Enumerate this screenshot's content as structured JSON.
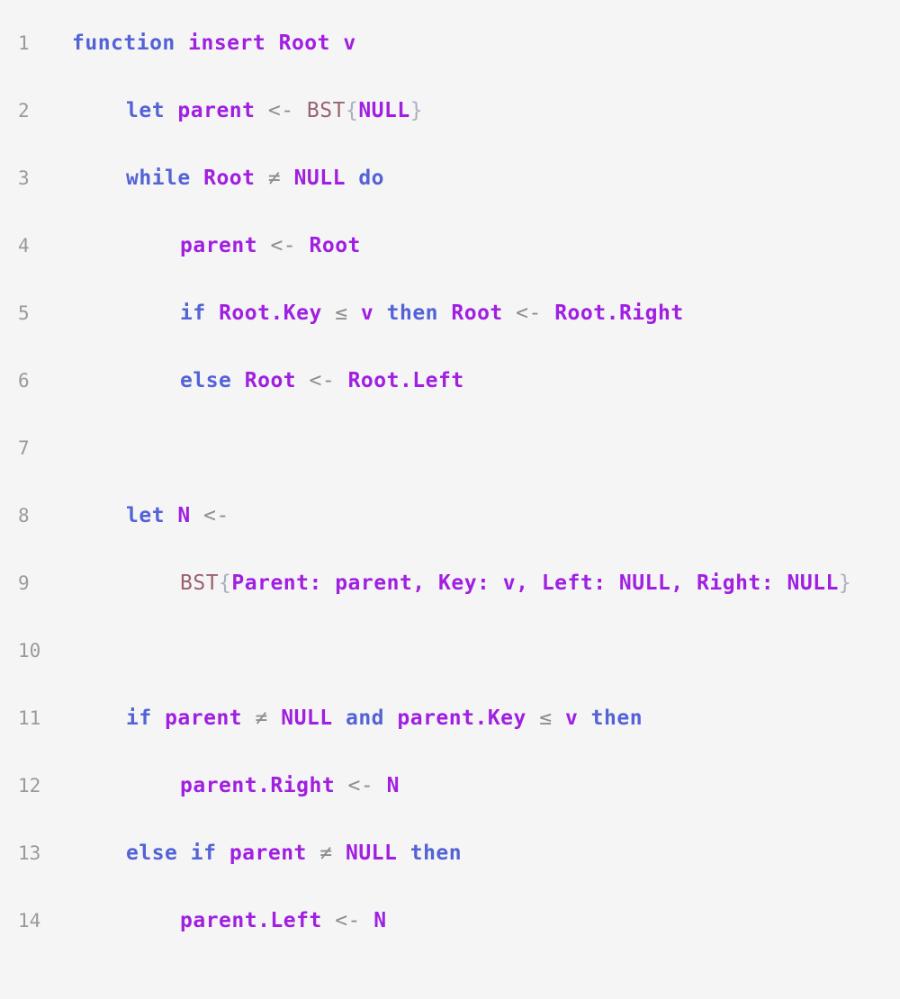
{
  "editor": {
    "lines": [
      {
        "number": "1",
        "indent": 0,
        "tokens": [
          {
            "t": "function",
            "k": "keyword"
          },
          {
            "t": " ",
            "k": "op"
          },
          {
            "t": "insert",
            "k": "ident"
          },
          {
            "t": " ",
            "k": "op"
          },
          {
            "t": "Root",
            "k": "ident"
          },
          {
            "t": " ",
            "k": "op"
          },
          {
            "t": "v",
            "k": "ident"
          }
        ]
      },
      {
        "number": "2",
        "indent": 1,
        "tokens": [
          {
            "t": "let",
            "k": "keyword"
          },
          {
            "t": " ",
            "k": "op"
          },
          {
            "t": "parent",
            "k": "ident"
          },
          {
            "t": " ",
            "k": "op"
          },
          {
            "t": "<-",
            "k": "op"
          },
          {
            "t": " ",
            "k": "op"
          },
          {
            "t": "BST",
            "k": "type"
          },
          {
            "t": "{",
            "k": "brace"
          },
          {
            "t": "NULL",
            "k": "ident"
          },
          {
            "t": "}",
            "k": "brace"
          }
        ]
      },
      {
        "number": "3",
        "indent": 1,
        "tokens": [
          {
            "t": "while",
            "k": "keyword"
          },
          {
            "t": " ",
            "k": "op"
          },
          {
            "t": "Root",
            "k": "ident"
          },
          {
            "t": " ",
            "k": "op"
          },
          {
            "t": "≠",
            "k": "op"
          },
          {
            "t": " ",
            "k": "op"
          },
          {
            "t": "NULL",
            "k": "ident"
          },
          {
            "t": " ",
            "k": "op"
          },
          {
            "t": "do",
            "k": "keyword"
          }
        ]
      },
      {
        "number": "4",
        "indent": 2,
        "tokens": [
          {
            "t": "parent",
            "k": "ident"
          },
          {
            "t": " ",
            "k": "op"
          },
          {
            "t": "<-",
            "k": "op"
          },
          {
            "t": " ",
            "k": "op"
          },
          {
            "t": "Root",
            "k": "ident"
          }
        ]
      },
      {
        "number": "5",
        "indent": 2,
        "tokens": [
          {
            "t": "if",
            "k": "keyword"
          },
          {
            "t": " ",
            "k": "op"
          },
          {
            "t": "Root.Key",
            "k": "ident"
          },
          {
            "t": " ",
            "k": "op"
          },
          {
            "t": "≤",
            "k": "op"
          },
          {
            "t": " ",
            "k": "op"
          },
          {
            "t": "v",
            "k": "ident"
          },
          {
            "t": " ",
            "k": "op"
          },
          {
            "t": "then",
            "k": "keyword"
          },
          {
            "t": " ",
            "k": "op"
          },
          {
            "t": "Root",
            "k": "ident"
          },
          {
            "t": " ",
            "k": "op"
          },
          {
            "t": "<-",
            "k": "op"
          },
          {
            "t": " ",
            "k": "op"
          },
          {
            "t": "Root.Right",
            "k": "ident"
          }
        ]
      },
      {
        "number": "6",
        "indent": 2,
        "tokens": [
          {
            "t": "else",
            "k": "keyword"
          },
          {
            "t": " ",
            "k": "op"
          },
          {
            "t": "Root",
            "k": "ident"
          },
          {
            "t": " ",
            "k": "op"
          },
          {
            "t": "<-",
            "k": "op"
          },
          {
            "t": " ",
            "k": "op"
          },
          {
            "t": "Root.Left",
            "k": "ident"
          }
        ]
      },
      {
        "number": "7",
        "indent": 0,
        "tokens": []
      },
      {
        "number": "8",
        "indent": 1,
        "tokens": [
          {
            "t": "let",
            "k": "keyword"
          },
          {
            "t": " ",
            "k": "op"
          },
          {
            "t": "N",
            "k": "ident"
          },
          {
            "t": " ",
            "k": "op"
          },
          {
            "t": "<-",
            "k": "op"
          }
        ]
      },
      {
        "number": "9",
        "indent": 2,
        "tokens": [
          {
            "t": "BST",
            "k": "type"
          },
          {
            "t": "{",
            "k": "brace"
          },
          {
            "t": "Parent:",
            "k": "ident"
          },
          {
            "t": " ",
            "k": "op"
          },
          {
            "t": "parent,",
            "k": "ident"
          },
          {
            "t": " ",
            "k": "op"
          },
          {
            "t": "Key:",
            "k": "ident"
          },
          {
            "t": " ",
            "k": "op"
          },
          {
            "t": "v,",
            "k": "ident"
          },
          {
            "t": " ",
            "k": "op"
          },
          {
            "t": "Left:",
            "k": "ident"
          },
          {
            "t": " ",
            "k": "op"
          },
          {
            "t": "NULL,",
            "k": "ident"
          },
          {
            "t": " ",
            "k": "op"
          },
          {
            "t": "Right:",
            "k": "ident"
          },
          {
            "t": " ",
            "k": "op"
          },
          {
            "t": "NULL",
            "k": "ident"
          },
          {
            "t": "}",
            "k": "brace"
          }
        ]
      },
      {
        "number": "10",
        "indent": 0,
        "tokens": []
      },
      {
        "number": "11",
        "indent": 1,
        "tokens": [
          {
            "t": "if",
            "k": "keyword"
          },
          {
            "t": " ",
            "k": "op"
          },
          {
            "t": "parent",
            "k": "ident"
          },
          {
            "t": " ",
            "k": "op"
          },
          {
            "t": "≠",
            "k": "op"
          },
          {
            "t": " ",
            "k": "op"
          },
          {
            "t": "NULL",
            "k": "ident"
          },
          {
            "t": " ",
            "k": "op"
          },
          {
            "t": "and",
            "k": "keyword"
          },
          {
            "t": " ",
            "k": "op"
          },
          {
            "t": "parent.Key",
            "k": "ident"
          },
          {
            "t": " ",
            "k": "op"
          },
          {
            "t": "≤",
            "k": "op"
          },
          {
            "t": " ",
            "k": "op"
          },
          {
            "t": "v",
            "k": "ident"
          },
          {
            "t": " ",
            "k": "op"
          },
          {
            "t": "then",
            "k": "keyword"
          }
        ]
      },
      {
        "number": "12",
        "indent": 2,
        "tokens": [
          {
            "t": "parent.Right",
            "k": "ident"
          },
          {
            "t": " ",
            "k": "op"
          },
          {
            "t": "<-",
            "k": "op"
          },
          {
            "t": " ",
            "k": "op"
          },
          {
            "t": "N",
            "k": "ident"
          }
        ]
      },
      {
        "number": "13",
        "indent": 1,
        "tokens": [
          {
            "t": "else",
            "k": "keyword"
          },
          {
            "t": " ",
            "k": "op"
          },
          {
            "t": "if",
            "k": "keyword"
          },
          {
            "t": " ",
            "k": "op"
          },
          {
            "t": "parent",
            "k": "ident"
          },
          {
            "t": " ",
            "k": "op"
          },
          {
            "t": "≠",
            "k": "op"
          },
          {
            "t": " ",
            "k": "op"
          },
          {
            "t": "NULL",
            "k": "ident"
          },
          {
            "t": " ",
            "k": "op"
          },
          {
            "t": "then",
            "k": "keyword"
          }
        ]
      },
      {
        "number": "14",
        "indent": 2,
        "tokens": [
          {
            "t": "parent.Left",
            "k": "ident"
          },
          {
            "t": " ",
            "k": "op"
          },
          {
            "t": "<-",
            "k": "op"
          },
          {
            "t": " ",
            "k": "op"
          },
          {
            "t": "N",
            "k": "ident"
          }
        ]
      }
    ]
  },
  "colors": {
    "background": "#f5f5f6",
    "keyword": "#5363d6",
    "identifier": "#a01fe0",
    "operator": "#8d8d8d",
    "type": "#9a6270",
    "brace": "#aab0c0",
    "line_number": "#9a9a9a"
  }
}
